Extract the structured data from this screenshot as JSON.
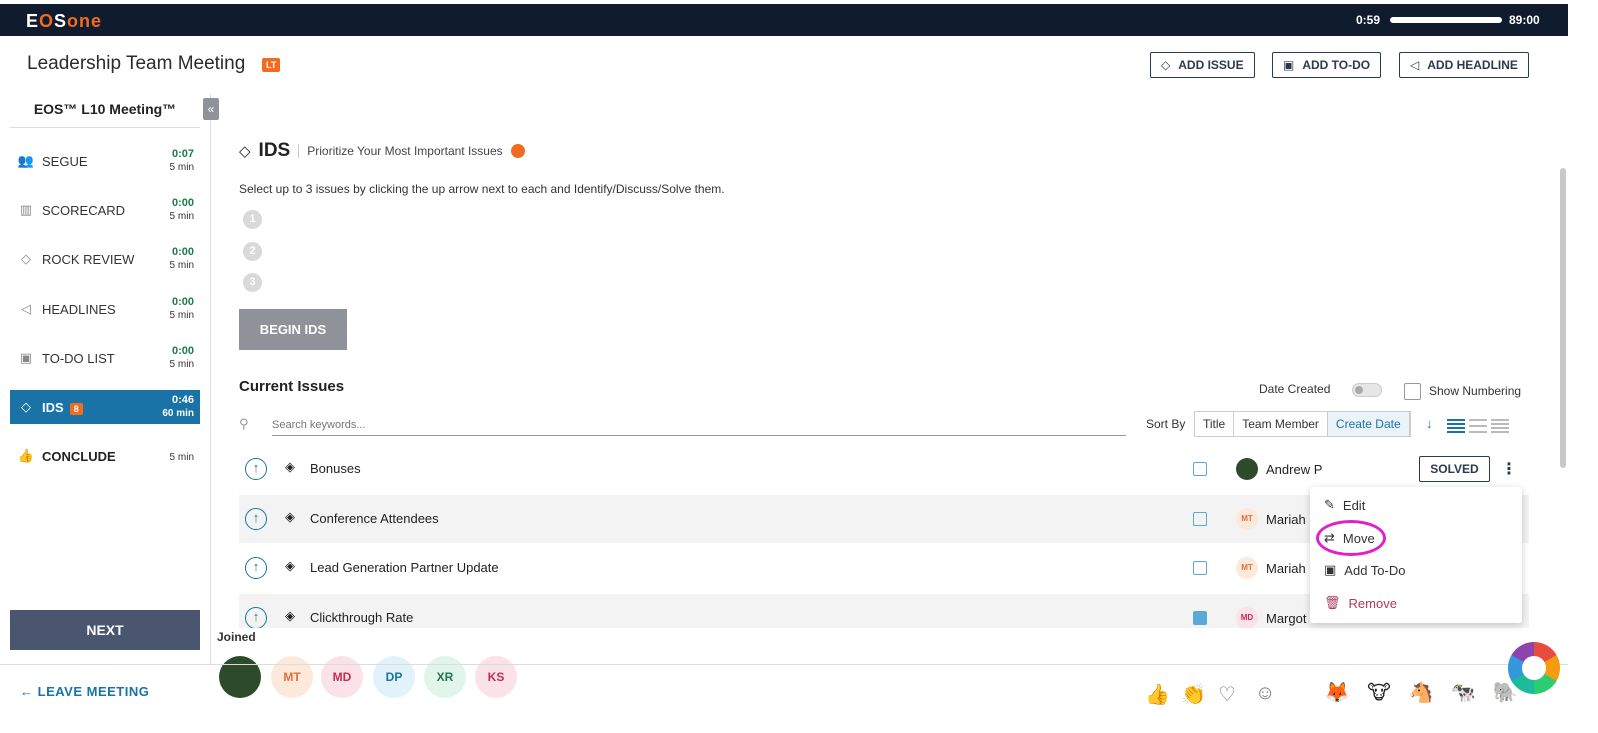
{
  "app": {
    "logo": "EOSone",
    "timer_elapsed": "0:59",
    "timer_total": "89:00"
  },
  "header": {
    "meeting_title": "Leadership Team Meeting",
    "meeting_badge": "LT",
    "buttons": {
      "add_issue": "ADD ISSUE",
      "add_todo": "ADD TO-DO",
      "add_headline": "ADD HEADLINE"
    }
  },
  "sidebar": {
    "title": "EOS™ L10 Meeting™",
    "items": [
      {
        "label": "SEGUE",
        "time": "0:07",
        "duration": "5 min"
      },
      {
        "label": "SCORECARD",
        "time": "0:00",
        "duration": "5 min"
      },
      {
        "label": "ROCK REVIEW",
        "time": "0:00",
        "duration": "5 min"
      },
      {
        "label": "HEADLINES",
        "time": "0:00",
        "duration": "5 min"
      },
      {
        "label": "TO-DO LIST",
        "time": "0:00",
        "duration": "5 min"
      },
      {
        "label": "IDS",
        "badge": "8",
        "time": "0:46",
        "duration": "60 min"
      },
      {
        "label": "CONCLUDE",
        "time": "",
        "duration": "5 min"
      }
    ],
    "next_label": "NEXT"
  },
  "ids": {
    "title": "IDS",
    "subtitle": "Prioritize Your Most Important Issues",
    "instructions": "Select up to 3 issues by clicking the up arrow next to each and Identify/Discuss/Solve them.",
    "slots": [
      "1",
      "2",
      "3"
    ],
    "begin_label": "BEGIN IDS"
  },
  "issues": {
    "title": "Current Issues",
    "date_created_label": "Date Created",
    "show_numbering_label": "Show Numbering",
    "search_placeholder": "Search keywords...",
    "sort_by_label": "Sort By",
    "sort_options": [
      "Title",
      "Team Member",
      "Create Date"
    ],
    "sort_selected": "Create Date",
    "rows": [
      {
        "title": "Bonuses",
        "owner": "Andrew P",
        "initials": "",
        "status": "SOLVED"
      },
      {
        "title": "Conference Attendees",
        "owner": "Mariah",
        "initials": "MT"
      },
      {
        "title": "Lead Generation Partner Update",
        "owner": "Mariah",
        "initials": "MT"
      },
      {
        "title": "Clickthrough Rate",
        "owner": "Margot",
        "initials": "MD"
      }
    ]
  },
  "context_menu": {
    "items": [
      "Edit",
      "Move",
      "Add To-Do",
      "Remove"
    ]
  },
  "footer": {
    "joined_label": "Joined",
    "attendees": [
      "MT",
      "MD",
      "DP",
      "XR",
      "KS"
    ],
    "leave_label": "LEAVE MEETING"
  },
  "colors": {
    "brand_dark": "#101b2d",
    "accent_blue": "#1a73a7",
    "accent_orange": "#f26b21",
    "highlight_ring": "#e020c8"
  }
}
